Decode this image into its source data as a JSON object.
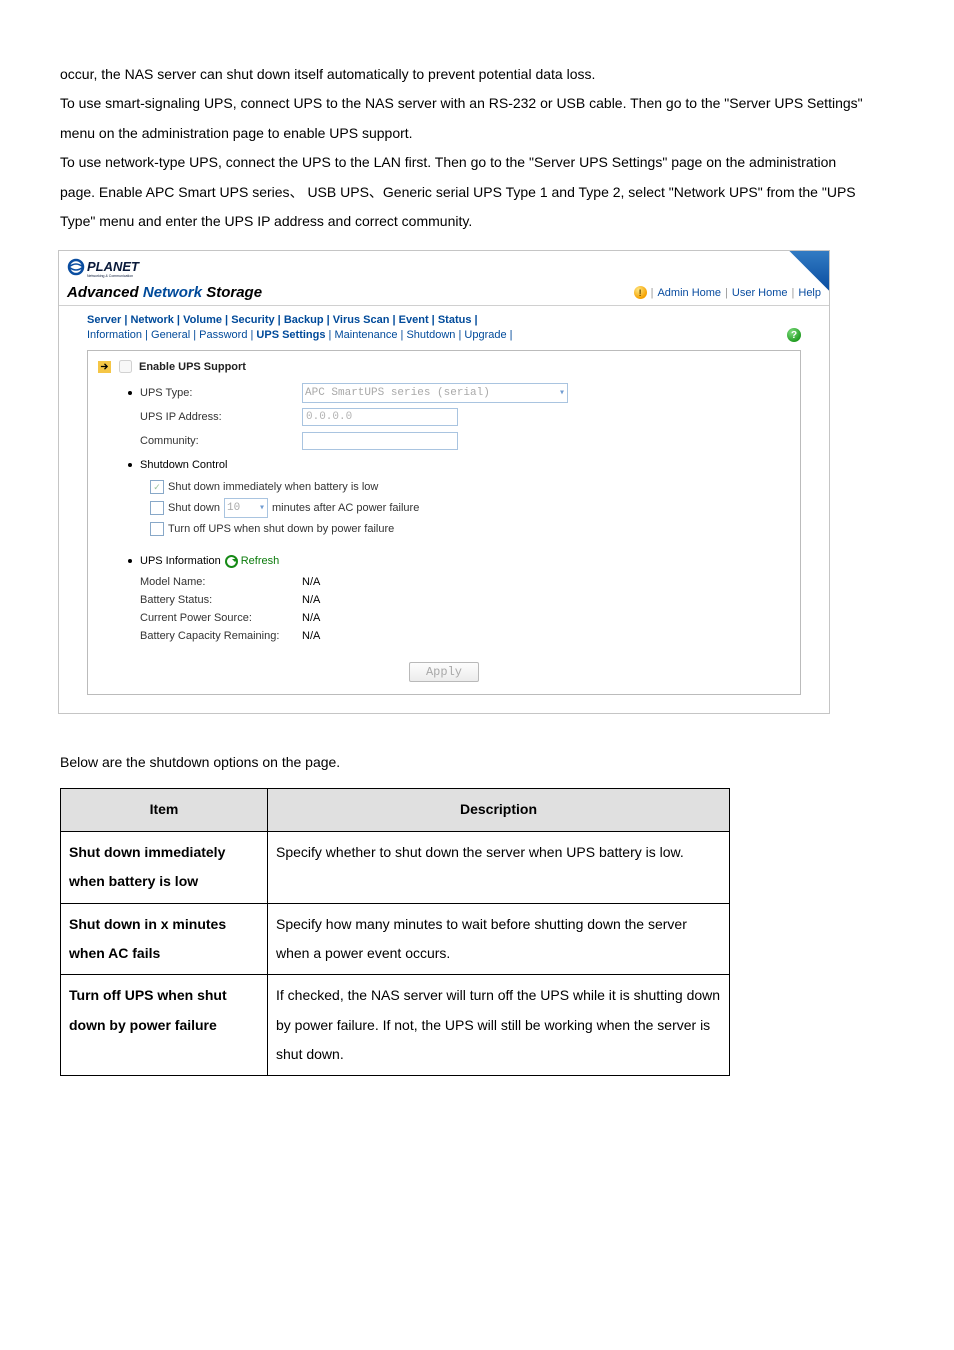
{
  "intro": {
    "p1": "occur, the NAS server can shut down itself automatically to prevent potential data loss.",
    "p2": "To use smart-signaling UPS, connect UPS to the NAS server with an RS-232 or USB cable. Then go to the \"Server UPS Settings\" menu on the administration page to enable UPS support.",
    "p3": "To use network-type UPS, connect the UPS to the LAN first. Then go to the \"Server UPS Settings\" page on the administration page. Enable APC Smart UPS series、 USB UPS、Generic serial UPS Type 1 and Type 2, select \"Network UPS\" from the \"UPS Type\" menu and enter the UPS IP address and correct community."
  },
  "screenshot": {
    "brand_sub": "Networking & Communication",
    "title_prefix": "Advanced ",
    "title_accent": "Network",
    "title_suffix": " Storage",
    "toplinks": {
      "admin": "Admin Home",
      "user": "User Home",
      "help": "Help"
    },
    "maintabs": [
      "Server",
      "Network",
      "Volume",
      "Security",
      "Backup",
      "Virus Scan",
      "Event",
      "Status"
    ],
    "subtabs": [
      "Information",
      "General",
      "Password",
      "UPS Settings",
      "Maintenance",
      "Shutdown",
      "Upgrade"
    ],
    "subtab_active_index": 3,
    "enable_label": "Enable UPS Support",
    "fields": {
      "ups_type_label": "UPS Type:",
      "ups_type_value": "APC SmartUPS series (serial)",
      "ups_ip_label": "UPS IP Address:",
      "ups_ip_value": "0.0.0.0",
      "community_label": "Community:"
    },
    "shutdown_control": {
      "heading": "Shutdown Control",
      "opt1": "Shut down immediately when battery is low",
      "opt2_pre": "Shut down",
      "opt2_val": "10",
      "opt2_post": "minutes after AC power failure",
      "opt3": "Turn off UPS when shut down by power failure"
    },
    "info": {
      "heading": "UPS Information",
      "refresh": "Refresh",
      "rows": [
        {
          "label": "Model Name:",
          "value": "N/A"
        },
        {
          "label": "Battery Status:",
          "value": "N/A"
        },
        {
          "label": "Current Power Source:",
          "value": "N/A"
        },
        {
          "label": "Battery Capacity Remaining:",
          "value": "N/A"
        }
      ]
    },
    "apply": "Apply"
  },
  "below": "Below are the shutdown options on the page.",
  "table": {
    "headers": {
      "item": "Item",
      "desc": "Description"
    },
    "rows": [
      {
        "item": "Shut down immediately when battery is low",
        "desc": "Specify whether to shut down the server when UPS battery is low."
      },
      {
        "item": "Shut down in x minutes when AC fails",
        "desc": "Specify how many minutes to wait before shutting down the server when a power event occurs."
      },
      {
        "item": "Turn off UPS when shut down by power failure",
        "desc": "If checked, the NAS server will turn off the UPS while it is shutting down by power failure. If not, the UPS will still be working when the server is shut down."
      }
    ]
  }
}
